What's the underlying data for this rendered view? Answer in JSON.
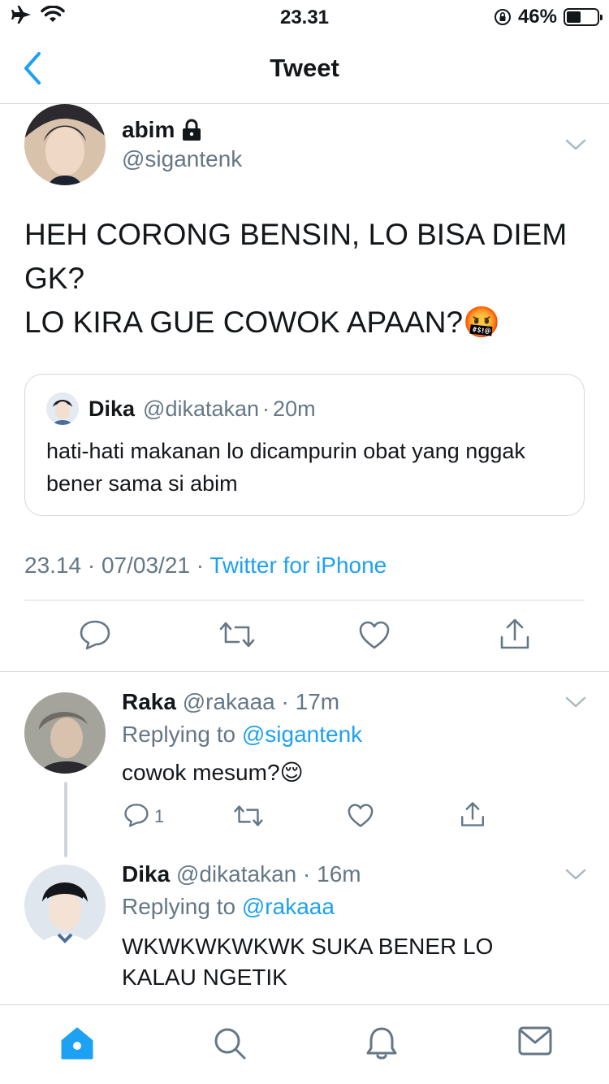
{
  "status_bar": {
    "time": "23.31",
    "battery_pct": "46%",
    "battery_level": 0.46
  },
  "nav": {
    "title": "Tweet"
  },
  "tweet": {
    "author_name": "abim",
    "author_handle": "@sigantenk",
    "text_lines": [
      "HEH CORONG BENSIN, LO BISA DIEM GK?",
      "LO KIRA GUE COWOK APAAN?"
    ],
    "emoji": "🤬",
    "quote": {
      "name": "Dika",
      "handle": "@dikatakan",
      "dot": "·",
      "time": "20m",
      "text": "hati-hati makanan lo dicampurin obat yang nggak bener sama si abim"
    },
    "time": "23.14",
    "date": "07/03/21",
    "source": "Twitter for iPhone",
    "dot": "·"
  },
  "replies": [
    {
      "name": "Raka",
      "handle": "@rakaaa",
      "time": "17m",
      "replying_label": "Replying to",
      "replying_to": "@sigantenk",
      "text": "cowok mesum?",
      "emoji": "😌",
      "reply_count": "1"
    },
    {
      "name": "Dika",
      "handle": "@dikatakan",
      "time": "16m",
      "replying_label": "Replying to",
      "replying_to": "@rakaaa",
      "text": "WKWKWKWKWK SUKA BENER LO KALAU NGETIK"
    }
  ],
  "icons": {
    "status": [
      "airplane-icon",
      "wifi-icon",
      "orientation-lock-icon",
      "battery-icon"
    ],
    "actions": [
      "reply-icon",
      "retweet-icon",
      "like-icon",
      "share-icon"
    ],
    "tabs": [
      "home-icon",
      "search-icon",
      "notifications-icon",
      "messages-icon"
    ]
  },
  "colors": {
    "accent": "#1da1f2",
    "secondary_text": "#657786",
    "divider": "#d4d7db"
  }
}
